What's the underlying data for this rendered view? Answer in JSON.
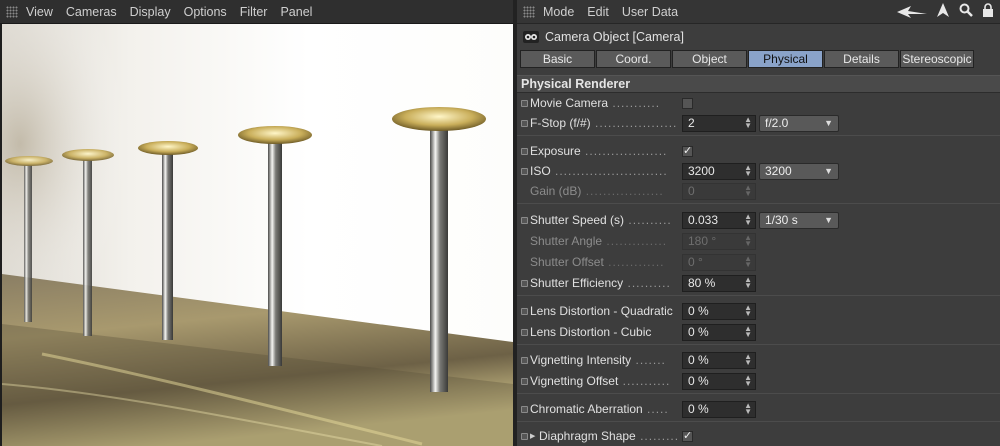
{
  "viewport": {
    "menu": [
      "View",
      "Cameras",
      "Display",
      "Options",
      "Filter",
      "Panel"
    ]
  },
  "attribute_manager": {
    "menu": [
      "Mode",
      "Edit",
      "User Data"
    ],
    "tool_icons": [
      "back-arrow-icon",
      "up-arrow-icon",
      "search-icon",
      "lock-icon"
    ],
    "object_title": "Camera Object [Camera]",
    "tabs": [
      {
        "label": "Basic",
        "active": false
      },
      {
        "label": "Coord.",
        "active": false
      },
      {
        "label": "Object",
        "active": false
      },
      {
        "label": "Physical",
        "active": true
      },
      {
        "label": "Details",
        "active": false
      },
      {
        "label": "Stereoscopic",
        "active": false
      }
    ],
    "section_title": "Physical Renderer",
    "params": {
      "movie_camera": {
        "label": "Movie Camera",
        "checked": false
      },
      "fstop": {
        "label": "F-Stop (f/#)",
        "value": "2",
        "preset": "f/2.0"
      },
      "exposure": {
        "label": "Exposure",
        "checked": true
      },
      "iso": {
        "label": "ISO",
        "value": "3200",
        "preset": "3200"
      },
      "gain": {
        "label": "Gain (dB)",
        "value": "0"
      },
      "shutter_speed": {
        "label": "Shutter Speed (s)",
        "value": "0.033",
        "preset": "1/30 s"
      },
      "shutter_angle": {
        "label": "Shutter Angle",
        "value": "180 °"
      },
      "shutter_offset": {
        "label": "Shutter Offset",
        "value": "0 °"
      },
      "shutter_efficiency": {
        "label": "Shutter Efficiency",
        "value": "80 %"
      },
      "lens_quadratic": {
        "label": "Lens Distortion - Quadratic",
        "value": "0 %"
      },
      "lens_cubic": {
        "label": "Lens Distortion - Cubic",
        "value": "0 %"
      },
      "vignetting_intensity": {
        "label": "Vignetting Intensity",
        "value": "0 %"
      },
      "vignetting_offset": {
        "label": "Vignetting Offset",
        "value": "0 %"
      },
      "chromatic_aberration": {
        "label": "Chromatic Aberration",
        "value": "0 %"
      },
      "diaphragm_shape": {
        "label": "Diaphragm Shape",
        "checked": true
      }
    }
  },
  "colors": {
    "active_tab": "#8aa3c9",
    "panel_bg": "#3d3d3d"
  }
}
